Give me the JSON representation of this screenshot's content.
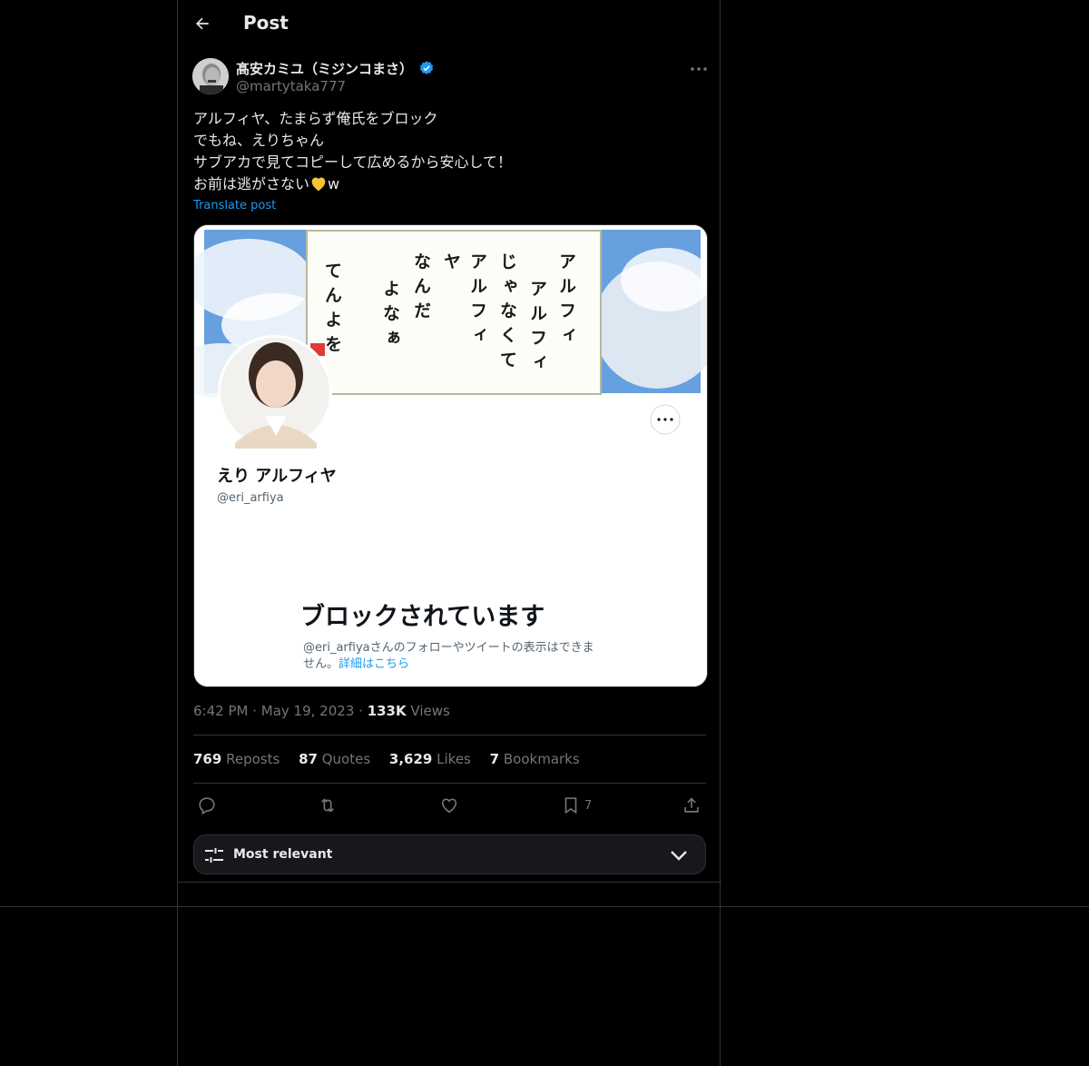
{
  "header": {
    "title": "Post",
    "back_icon": "arrow-left-icon"
  },
  "author": {
    "name": "髙安カミユ（ミジンコまさ）",
    "handle": "@martytaka777",
    "verified": true
  },
  "post": {
    "lines": [
      "アルフィヤ、たまらず俺氏をブロック",
      "でもね、えりちゃん",
      "サブアカで見てコピーして広めるから安心して！",
      "お前は逃がさない"
    ],
    "last_line_suffix": "w",
    "translate_label": "Translate post"
  },
  "media": {
    "sign_columns": [
      "アルフィ",
      "アルフィ",
      "じゃなくて",
      "アルフィ",
      "ヤ",
      "なんだ",
      "よなぁ",
      "てんよを"
    ],
    "profile_name": "えり アルフィヤ",
    "profile_handle": "@eri_arfiya",
    "blocked_title": "ブロックされています",
    "blocked_desc_1": "@eri_arfiyaさんのフォローやツイートの表示はできま",
    "blocked_desc_2_prefix": "せん。",
    "blocked_link": "詳細はこちら"
  },
  "meta": {
    "time": "6:42 PM",
    "date": "May 19, 2023",
    "views_count": "133K",
    "views_label": "Views"
  },
  "stats": [
    {
      "count": "769",
      "label": "Reposts"
    },
    {
      "count": "87",
      "label": "Quotes"
    },
    {
      "count": "3,629",
      "label": "Likes"
    },
    {
      "count": "7",
      "label": "Bookmarks"
    }
  ],
  "actions": {
    "bookmark_count": "7"
  },
  "sort": {
    "label": "Most relevant"
  },
  "colors": {
    "accent": "#1d9bf0",
    "background": "#000000",
    "border": "#2f3336",
    "muted": "#71767b"
  }
}
